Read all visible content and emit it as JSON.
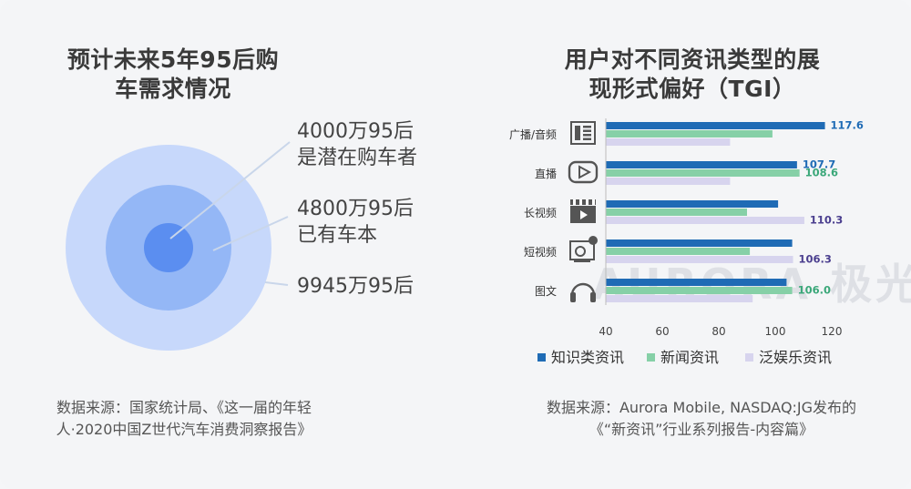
{
  "left": {
    "title_line1": "预计未来5年95后购",
    "title_line2": "车需求情况",
    "labels": [
      {
        "line1": "4000万95后",
        "line2": "是潜在购车者"
      },
      {
        "line1": "4800万95后",
        "line2": "已有车本"
      },
      {
        "line1": "9945万95后",
        "line2": ""
      }
    ],
    "source_line1": "数据来源：国家统计局、《这一届的年轻",
    "source_line2": "人·2020中国Z世代汽车消费洞察报告》",
    "colors": {
      "outer": "#c7d8fb",
      "middle": "#94b7f6",
      "inner": "#5b8ef0"
    }
  },
  "right": {
    "title_line1": "用户对不同资讯类型的展",
    "title_line2": "现形式偏好（TGI）",
    "source_line1": "数据来源：Aurora Mobile, NASDAQ:JG发布的",
    "source_line2": "《“新资讯”行业系列报告-内容篇》",
    "watermark": "AURORA 极光"
  },
  "chart_data": {
    "type": "bar",
    "orientation": "horizontal",
    "categories": [
      "广播/音频",
      "直播",
      "长视频",
      "短视频",
      "图文"
    ],
    "category_icons": [
      "audio-panel-icon",
      "live-play-icon",
      "clapperboard-icon",
      "short-video-icon",
      "headphones-icon"
    ],
    "series": [
      {
        "name": "知识类资讯",
        "color": "#1f6bb5",
        "values": [
          117.6,
          107.7,
          101,
          106,
          104
        ]
      },
      {
        "name": "新闻资讯",
        "color": "#86d0a7",
        "values": [
          99,
          108.6,
          90,
          91,
          106.0
        ]
      },
      {
        "name": "泛娱乐资讯",
        "color": "#d7d4ee",
        "values": [
          84,
          84,
          110.3,
          106.3,
          92
        ]
      }
    ],
    "data_labels": [
      {
        "category": 0,
        "series": 0,
        "text": "117.6",
        "color": "#1f6bb5"
      },
      {
        "category": 1,
        "series": 0,
        "text": "107.7",
        "color": "#1f6bb5"
      },
      {
        "category": 1,
        "series": 1,
        "text": "108.6",
        "color": "#3aa779"
      },
      {
        "category": 2,
        "series": 2,
        "text": "110.3",
        "color": "#4b3f8f"
      },
      {
        "category": 3,
        "series": 2,
        "text": "106.3",
        "color": "#4b3f8f"
      },
      {
        "category": 4,
        "series": 1,
        "text": "106.0",
        "color": "#3aa779"
      }
    ],
    "xlim": [
      40,
      120
    ],
    "xticks": [
      "40",
      "60",
      "80",
      "100",
      "120"
    ],
    "legend_position": "bottom",
    "grid": false
  }
}
